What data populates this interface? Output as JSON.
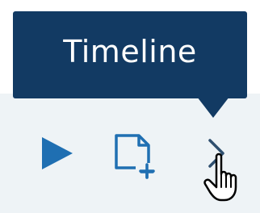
{
  "tooltip": {
    "label": "Timeline"
  },
  "toolbar": {
    "buttons": [
      {
        "name": "play",
        "icon": "play-icon"
      },
      {
        "name": "new-document",
        "icon": "new-document-icon"
      },
      {
        "name": "next",
        "icon": "chevron-right-icon"
      }
    ]
  },
  "colors": {
    "tooltip_bg": "#123a63",
    "tooltip_text": "#ffffff",
    "toolbar_bg": "#eef3f6",
    "icon_primary": "#1f6fb2",
    "icon_muted": "#2f4f6f"
  }
}
